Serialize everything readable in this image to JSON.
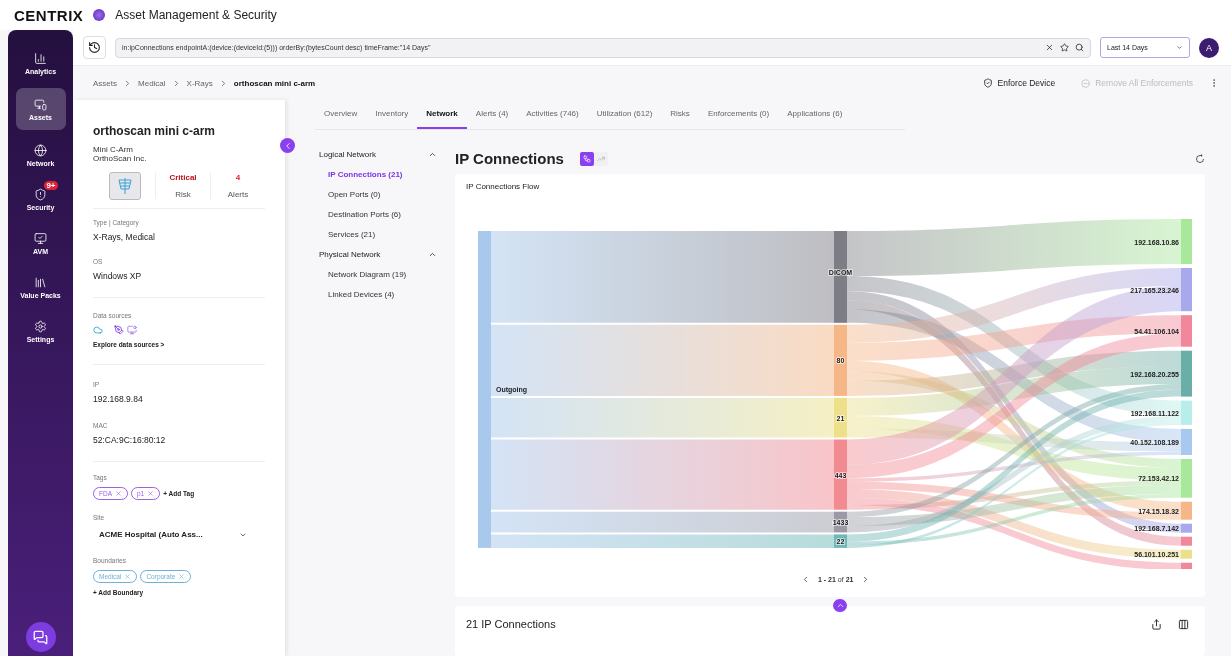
{
  "app": {
    "brand": "CENTRIX",
    "title": "Asset Management & Security"
  },
  "nav": [
    {
      "label": "Analytics",
      "selected": false
    },
    {
      "label": "Assets",
      "selected": true
    },
    {
      "label": "Network",
      "selected": false
    },
    {
      "label": "Security",
      "selected": false,
      "badge": "9+"
    },
    {
      "label": "AVM",
      "selected": false
    },
    {
      "label": "Value Packs",
      "selected": false
    },
    {
      "label": "Settings",
      "selected": false
    }
  ],
  "query": {
    "value": "in:ipConnections endpointA:(device:(deviceId:(5))) orderBy:(bytesCount desc) timeFrame:\"14 Days\""
  },
  "time_range": "Last 14 Days",
  "avatar": "A",
  "breadcrumb": [
    "Assets",
    "Medical",
    "X-Rays",
    "orthoscan mini c-arm"
  ],
  "actions": [
    {
      "label": "Enforce Device",
      "disabled": false
    },
    {
      "label": "Remove All Enforcements",
      "disabled": true
    }
  ],
  "device": {
    "name": "orthoscan mini c-arm",
    "model": "Mini C-Arm",
    "vendor": "OrthoScan Inc.",
    "risk": {
      "value": "Critical",
      "label": "Risk"
    },
    "alerts": {
      "value": "4",
      "label": "Alerts"
    },
    "type": {
      "label": "Type | Category",
      "value": "X-Rays, Medical"
    },
    "os": {
      "label": "OS",
      "value": "Windows XP"
    },
    "data_sources": {
      "label": "Data sources",
      "link": "Explore data sources >"
    },
    "ip": {
      "label": "IP",
      "value": "192.168.9.84"
    },
    "mac": {
      "label": "MAC",
      "value": "52:CA:9C:16:80:12"
    },
    "tags": {
      "label": "Tags",
      "items": [
        "FDA",
        "p1"
      ],
      "add": "+ Add Tag"
    },
    "site": {
      "label": "Site",
      "value": "ACME Hospital (Auto Ass..."
    },
    "boundaries": {
      "label": "Boundaries",
      "items": [
        "Medical",
        "Corporate"
      ],
      "add": "+ Add Boundary"
    }
  },
  "tabs": [
    {
      "label": "Overview",
      "selected": false
    },
    {
      "label": "Inventory",
      "selected": false
    },
    {
      "label": "Network",
      "selected": true
    },
    {
      "label": "Alerts (4)",
      "selected": false
    },
    {
      "label": "Activities (746)",
      "selected": false
    },
    {
      "label": "Utilization (612)",
      "selected": false
    },
    {
      "label": "Risks",
      "selected": false
    },
    {
      "label": "Enforcements (0)",
      "selected": false
    },
    {
      "label": "Applications (6)",
      "selected": false
    }
  ],
  "subnav": [
    {
      "label": "Logical Network",
      "expanded": true,
      "children": [
        {
          "label": "IP Connections (21)",
          "selected": true
        },
        {
          "label": "Open Ports (0)",
          "selected": false
        },
        {
          "label": "Destination Ports (6)",
          "selected": false
        },
        {
          "label": "Services (21)",
          "selected": false
        }
      ]
    },
    {
      "label": "Physical Network",
      "expanded": true,
      "children": [
        {
          "label": "Network Diagram (19)",
          "selected": false
        },
        {
          "label": "Linked Devices (4)",
          "selected": false
        }
      ]
    }
  ],
  "section": {
    "title": "IP Connections",
    "views": [
      {
        "selected": true
      },
      {
        "selected": false
      }
    ]
  },
  "chart": {
    "title": "IP Connections Flow",
    "source": {
      "label": "Outgoing",
      "color": "#a8c8ec"
    },
    "ports": [
      {
        "label": "DICOM",
        "color": "#7d7d85"
      },
      {
        "label": "80",
        "color": "#f5b787"
      },
      {
        "label": "21",
        "color": "#ece08a"
      },
      {
        "label": "443",
        "color": "#f28a92"
      },
      {
        "label": "1433",
        "color": "#9a9aa6"
      },
      {
        "label": "22",
        "color": "#6fb8b6"
      }
    ],
    "destinations": [
      {
        "label": "192.168.10.86",
        "color": "#a8e89a"
      },
      {
        "label": "217.165.23.246",
        "color": "#a8a8ec"
      },
      {
        "label": "54.41.106.104",
        "color": "#f0879a"
      },
      {
        "label": "192.168.20.255",
        "color": "#6aaea8"
      },
      {
        "label": "192.168.11.122",
        "color": "#b8eeea"
      },
      {
        "label": "40.152.108.189",
        "color": "#a8c8f0"
      },
      {
        "label": "72.153.42.12",
        "color": "#a8e89a"
      },
      {
        "label": "174.15.18.32",
        "color": "#f5b787"
      },
      {
        "label": "192.168.7.142",
        "color": "#a8a8ec"
      },
      {
        "color": "#f0879a"
      },
      {
        "label": "56.101.10.251",
        "color": "#ece08a"
      },
      {
        "color": "#f0879a"
      }
    ]
  },
  "pagination": {
    "range": "**1 - 21** of **21**"
  },
  "table": {
    "title": "21 IP Connections"
  }
}
